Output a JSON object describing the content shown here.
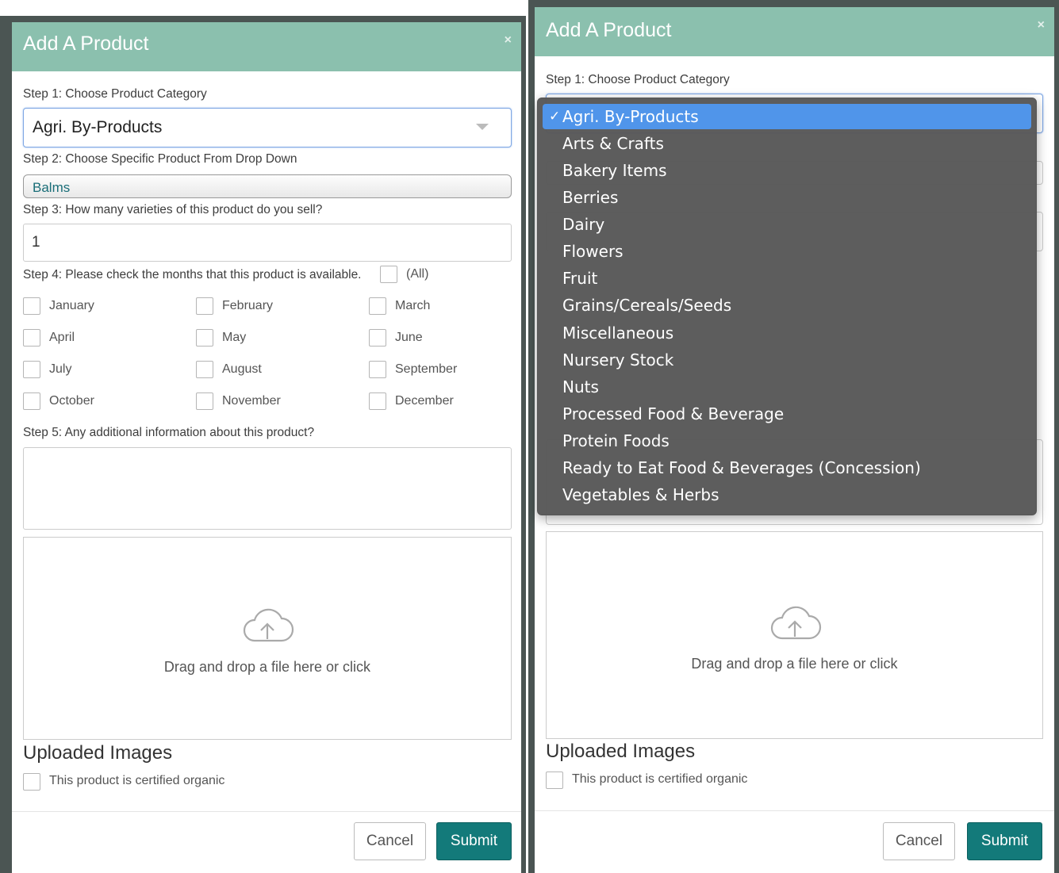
{
  "modal": {
    "title": "Add A Product",
    "close": "×"
  },
  "step1": {
    "label": "Step 1: Choose Product Category",
    "selected": "Agri. By-Products"
  },
  "step2": {
    "label": "Step 2: Choose Specific Product From Drop Down",
    "selected": "Balms"
  },
  "step3": {
    "label": "Step 3: How many varieties of this product do you sell?",
    "value": "1"
  },
  "step4": {
    "label": "Step 4: Please check the months that this product is available.",
    "all_label": "(All)",
    "months": [
      "January",
      "February",
      "March",
      "April",
      "May",
      "June",
      "July",
      "August",
      "September",
      "October",
      "November",
      "December"
    ]
  },
  "step5": {
    "label": "Step 5: Any additional information about this product?",
    "value": ""
  },
  "dropzone": {
    "text": "Drag and drop a file here or click"
  },
  "uploaded_images": {
    "title": "Uploaded Images"
  },
  "organic": {
    "label": "This product is certified organic"
  },
  "buttons": {
    "cancel": "Cancel",
    "submit": "Submit"
  },
  "category_dropdown": {
    "check_mark": "✓",
    "selected_index": 0,
    "options": [
      "Agri. By-Products",
      "Arts & Crafts",
      "Bakery Items",
      "Berries",
      "Dairy",
      "Flowers",
      "Fruit",
      "Grains/Cereals/Seeds",
      "Miscellaneous",
      "Nursery Stock",
      "Nuts",
      "Processed Food & Beverage",
      "Protein Foods",
      "Ready to Eat Food & Beverages (Concession)",
      "Vegetables & Herbs"
    ]
  },
  "colors": {
    "header": "#8bc0ae",
    "submit": "#137a7a",
    "dropdown_highlight": "#5095ea"
  }
}
